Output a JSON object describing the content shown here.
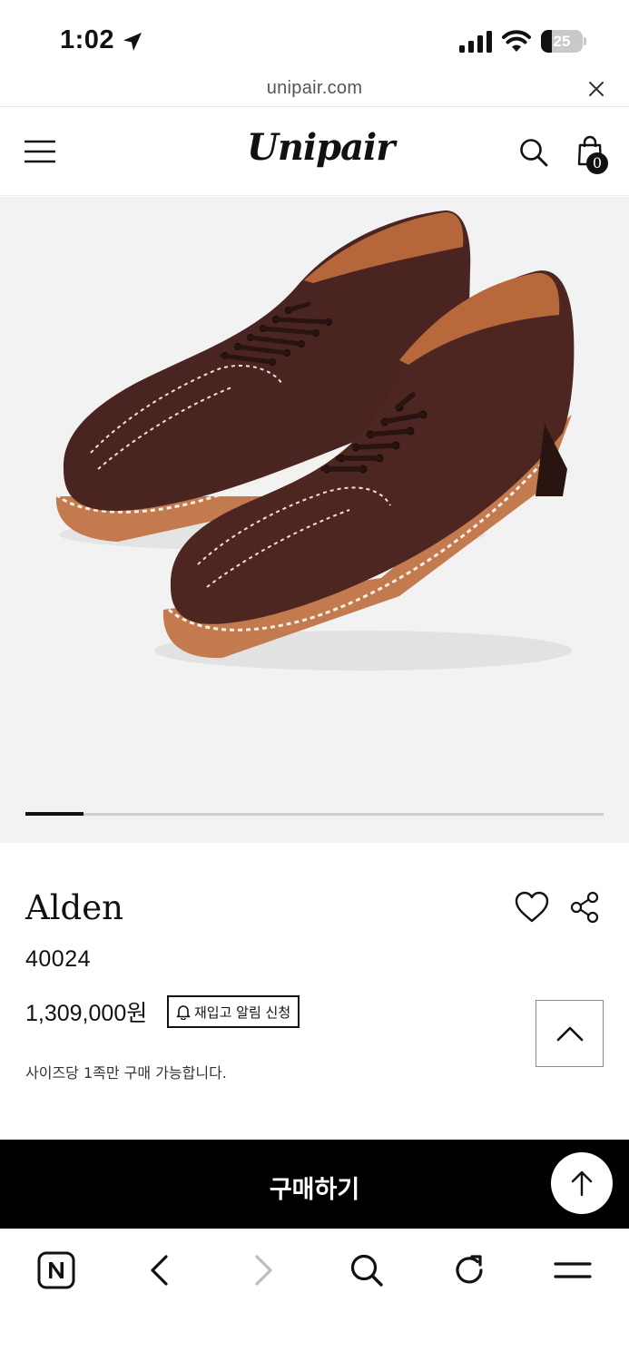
{
  "status_bar": {
    "time": "1:02",
    "battery": "25"
  },
  "browser": {
    "url": "unipair.com"
  },
  "header": {
    "logo": "Unipair",
    "cart_count": "0"
  },
  "carousel": {
    "current_slide": 1,
    "progress": 0.1
  },
  "product": {
    "brand": "Alden",
    "model": "40024",
    "price": "1,309,000원",
    "restock_label": "재입고 알림 신청",
    "note": "사이즈당 1족만 구매 가능합니다."
  },
  "buy_bar": {
    "label": "구매하기"
  },
  "colors": {
    "shoe_leather": "#4a2420",
    "sole": "#c27a4e",
    "image_background": "#f2f2f2",
    "buy_bar": "#000000"
  },
  "icons": {
    "header": [
      "menu-icon",
      "search-icon",
      "shopping-bag-icon"
    ],
    "product": [
      "heart-icon",
      "share-icon",
      "chevron-up-icon"
    ],
    "toolbar": [
      "naver-icon",
      "back-icon",
      "forward-icon",
      "search-icon",
      "reload-icon",
      "menu-icon"
    ]
  }
}
